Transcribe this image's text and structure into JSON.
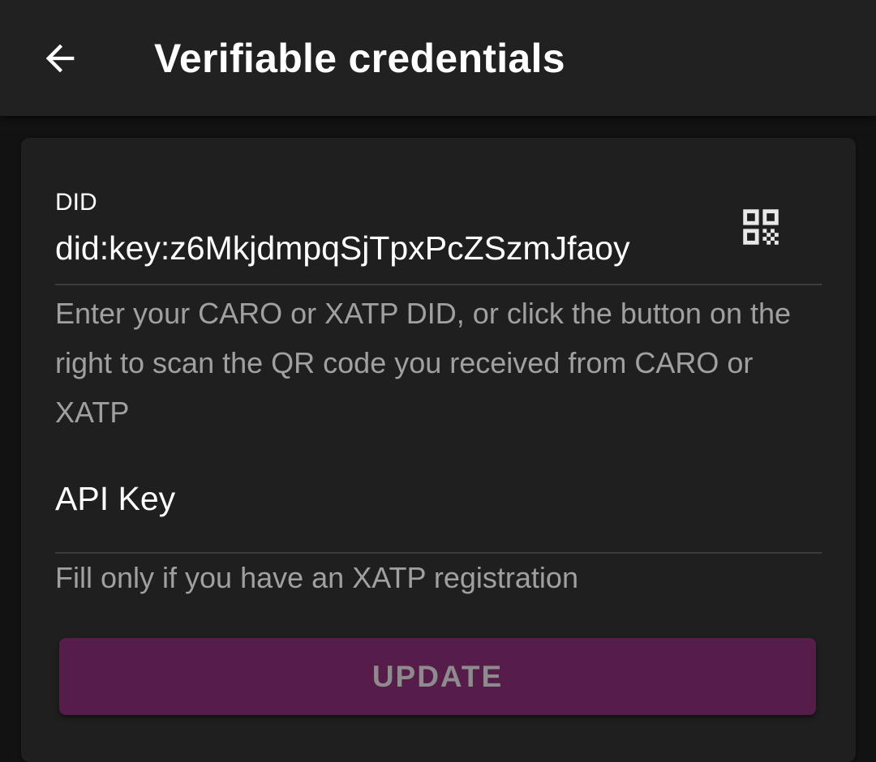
{
  "app_bar": {
    "back_icon": "arrow-left-icon",
    "title": "Verifiable credentials"
  },
  "form": {
    "did": {
      "label": "DID",
      "value": "did:key:z6MkjdmpqSjTpxPcZSzmJfaoy",
      "qr_icon": "qr-code-scan-icon",
      "helper": "Enter your CARO or XATP DID, or click the button on the right to scan the QR code you received from CARO or XATP"
    },
    "api_key": {
      "placeholder": "API Key",
      "value": "",
      "helper": "Fill only if you have an XATP registration"
    },
    "update_button": {
      "label": "UPDATE",
      "enabled": false
    }
  },
  "colors": {
    "background": "#121212",
    "app_bar": "#212121",
    "card": "#1f1f1f",
    "primary_button": "#561d4a",
    "button_text_disabled": "#8f8a8e",
    "helper_text": "#a0a0a0"
  }
}
